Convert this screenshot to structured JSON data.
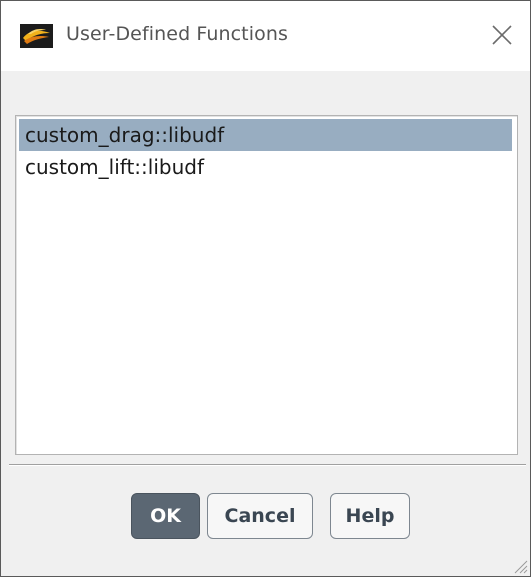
{
  "window": {
    "title": "User-Defined Functions",
    "icon": "ansys-fluent-logo-icon",
    "close_icon": "close-icon"
  },
  "functions_list": {
    "items": [
      {
        "label": "custom_drag::libudf",
        "selected": true
      },
      {
        "label": "custom_lift::libudf",
        "selected": false
      }
    ],
    "selection_color": "#98adc1"
  },
  "buttons": {
    "ok_label": "OK",
    "cancel_label": "Cancel",
    "help_label": "Help",
    "primary_color": "#5b6773"
  }
}
